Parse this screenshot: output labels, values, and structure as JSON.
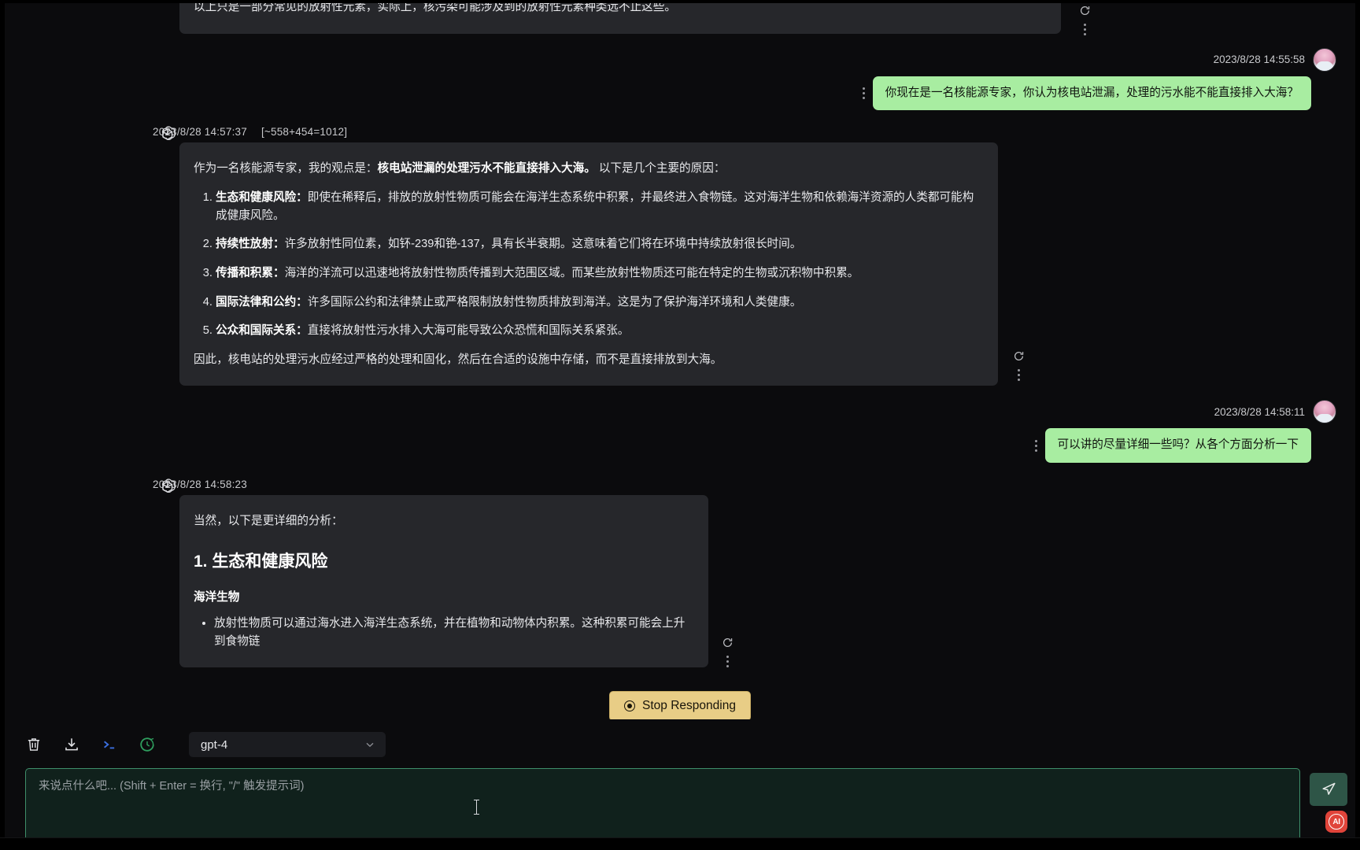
{
  "app": {
    "accent_green": "#a8eda1",
    "assistant_bubble_bg": "#26272b",
    "stop_button_bg": "#e8cd86"
  },
  "messages": [
    {
      "role": "assistant",
      "partial_tail": "以上只是一部分常见的放射性元素，实际上，核污染可能涉及到的放射性元素种类远不止这些。"
    },
    {
      "role": "user",
      "time": "2023/8/28 14:55:58",
      "text": "你现在是一名核能源专家，你认为核电站泄漏，处理的污水能不能直接排入大海？"
    },
    {
      "role": "assistant",
      "time": "2023/8/28 14:57:37",
      "tokens": "[~558+454=1012]",
      "intro_prefix": "作为一名核能源专家，我的观点是：",
      "intro_bold": "核电站泄漏的处理污水不能直接排入大海。",
      "intro_suffix": "以下是几个主要的原因：",
      "list": [
        {
          "term": "生态和健康风险：",
          "body": "即使在稀释后，排放的放射性物质可能会在海洋生态系统中积累，并最终进入食物链。这对海洋生物和依赖海洋资源的人类都可能构成健康风险。"
        },
        {
          "term": "持续性放射：",
          "body": "许多放射性同位素，如钚-239和铯-137，具有长半衰期。这意味着它们将在环境中持续放射很长时间。"
        },
        {
          "term": "传播和积累：",
          "body": "海洋的洋流可以迅速地将放射性物质传播到大范围区域。而某些放射性物质还可能在特定的生物或沉积物中积累。"
        },
        {
          "term": "国际法律和公约：",
          "body": "许多国际公约和法律禁止或严格限制放射性物质排放到海洋。这是为了保护海洋环境和人类健康。"
        },
        {
          "term": "公众和国际关系：",
          "body": "直接将放射性污水排入大海可能导致公众恐慌和国际关系紧张。"
        }
      ],
      "conclusion": "因此，核电站的处理污水应经过严格的处理和固化，然后在合适的设施中存储，而不是直接排放到大海。"
    },
    {
      "role": "user",
      "time": "2023/8/28 14:58:11",
      "text": "可以讲的尽量详细一些吗？从各个方面分析一下"
    },
    {
      "role": "assistant",
      "time": "2023/8/28 14:58:23",
      "intro": "当然，以下是更详细的分析：",
      "section_heading": "1. 生态和健康风险",
      "sub_heading": "海洋生物",
      "bullet": "放射性物质可以通过海水进入海洋生态系统，并在植物和动物体内积累。这种积累可能会上升到食物链"
    }
  ],
  "stop_button": {
    "label": "Stop Responding"
  },
  "toolbar": {
    "icons": [
      {
        "name": "clear-conversation-icon",
        "title": "trash-icon"
      },
      {
        "name": "export-icon",
        "title": "download-icon"
      },
      {
        "name": "terminal-icon",
        "title": "prompt-icon"
      },
      {
        "name": "history-icon",
        "title": "clock-icon"
      }
    ],
    "model": {
      "value": "gpt-4",
      "chevron": "⌄"
    }
  },
  "composer": {
    "placeholder": "来说点什么吧... (Shift + Enter = 换行, \"/\" 触发提示词)",
    "value": "",
    "send_label": "send-icon",
    "ai_badge_label": "AI"
  }
}
